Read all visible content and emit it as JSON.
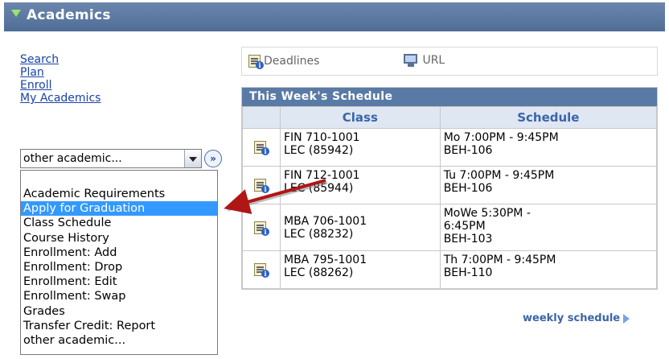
{
  "header": {
    "title": "Academics"
  },
  "nav_links": [
    "Search",
    "Plan",
    "Enroll",
    "My Academics"
  ],
  "select": {
    "value": "other academic...",
    "options": [
      "Academic Requirements",
      "Apply for Graduation",
      "Class Schedule",
      "Course History",
      "Enrollment: Add",
      "Enrollment: Drop",
      "Enrollment: Edit",
      "Enrollment: Swap",
      "Grades",
      "Transfer Credit: Report",
      "other academic..."
    ],
    "highlighted_option": "Apply for Graduation",
    "go_label": "»"
  },
  "toolbar": {
    "deadlines": "Deadlines",
    "url": "URL"
  },
  "schedule": {
    "title": "This Week's Schedule",
    "columns": [
      "Class",
      "Schedule"
    ],
    "rows": [
      {
        "class": [
          "FIN 710-1001",
          "LEC (85942)"
        ],
        "schedule": [
          "Mo 7:00PM - 9:45PM",
          "BEH-106"
        ]
      },
      {
        "class": [
          "FIN 712-1001",
          "LEC (85944)"
        ],
        "schedule": [
          "Tu 7:00PM - 9:45PM",
          "BEH-106"
        ]
      },
      {
        "class": [
          "MBA 706-1001",
          "LEC (88232)"
        ],
        "schedule": [
          "MoWe 5:30PM -",
          "6:45PM",
          "BEH-103"
        ]
      },
      {
        "class": [
          "MBA 795-1001",
          "LEC (88262)"
        ],
        "schedule": [
          "Th 7:00PM - 9:45PM",
          "BEH-110"
        ]
      }
    ]
  },
  "weekly_link": "weekly schedule",
  "colors": {
    "header": "#5a7aa6",
    "link": "#1a43a8",
    "highlight": "#3399ff",
    "arrow": "#b01616"
  },
  "icons": {
    "header": "triangle-down-icon",
    "deadlines": "calendar-info-icon",
    "url": "url-monitor-icon",
    "row": "calendar-info-icon"
  }
}
